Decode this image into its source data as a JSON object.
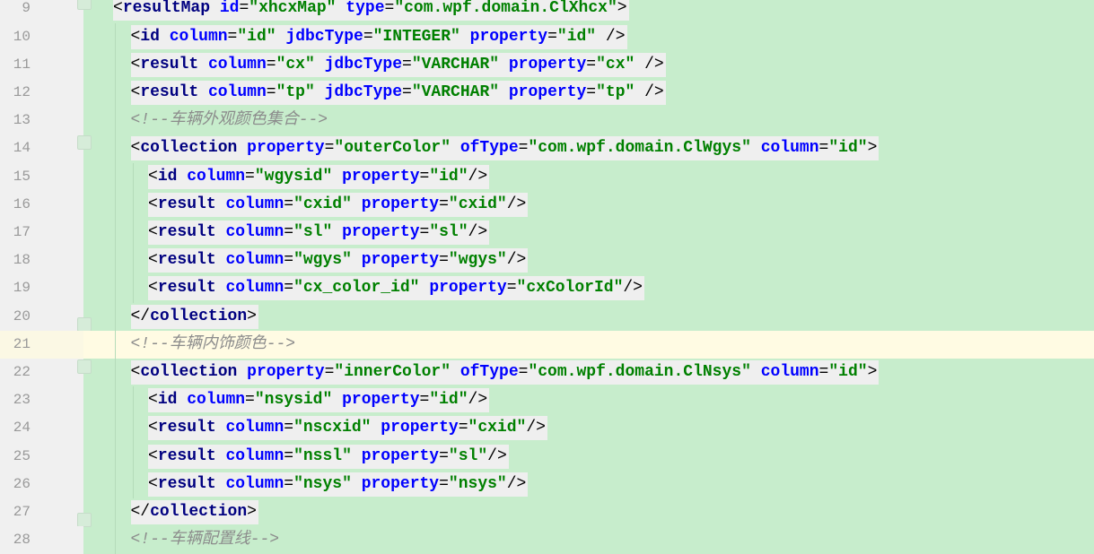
{
  "editor": {
    "current_line": 21,
    "colors": {
      "tag": "#000080",
      "attribute": "#0000ff",
      "value": "#008000",
      "comment": "#8c8c8c",
      "background": "#c7edcc",
      "current_line": "#fffbe3"
    },
    "lines": [
      {
        "n": "9",
        "indent": 0,
        "fold": "start",
        "tokens": [
          [
            "punct",
            "<"
          ],
          [
            "tag",
            "resultMap"
          ],
          [
            "punct",
            " "
          ],
          [
            "attr",
            "id"
          ],
          [
            "punct",
            "="
          ],
          [
            "val",
            "\"xhcxMap\""
          ],
          [
            "punct",
            " "
          ],
          [
            "attr",
            "type"
          ],
          [
            "punct",
            "="
          ],
          [
            "val",
            "\"com.wpf.domain.ClXhcx\""
          ],
          [
            "punct",
            ">"
          ]
        ]
      },
      {
        "n": "10",
        "indent": 1,
        "tokens": [
          [
            "punct",
            "<"
          ],
          [
            "tag",
            "id"
          ],
          [
            "punct",
            " "
          ],
          [
            "attr",
            "column"
          ],
          [
            "punct",
            "="
          ],
          [
            "val",
            "\"id\""
          ],
          [
            "punct",
            " "
          ],
          [
            "attr",
            "jdbcType"
          ],
          [
            "punct",
            "="
          ],
          [
            "val",
            "\"INTEGER\""
          ],
          [
            "punct",
            " "
          ],
          [
            "attr",
            "property"
          ],
          [
            "punct",
            "="
          ],
          [
            "val",
            "\"id\""
          ],
          [
            "punct",
            " />"
          ]
        ]
      },
      {
        "n": "11",
        "indent": 1,
        "tokens": [
          [
            "punct",
            "<"
          ],
          [
            "tag",
            "result"
          ],
          [
            "punct",
            " "
          ],
          [
            "attr",
            "column"
          ],
          [
            "punct",
            "="
          ],
          [
            "val",
            "\"cx\""
          ],
          [
            "punct",
            " "
          ],
          [
            "attr",
            "jdbcType"
          ],
          [
            "punct",
            "="
          ],
          [
            "val",
            "\"VARCHAR\""
          ],
          [
            "punct",
            " "
          ],
          [
            "attr",
            "property"
          ],
          [
            "punct",
            "="
          ],
          [
            "val",
            "\"cx\""
          ],
          [
            "punct",
            " />"
          ]
        ]
      },
      {
        "n": "12",
        "indent": 1,
        "tokens": [
          [
            "punct",
            "<"
          ],
          [
            "tag",
            "result"
          ],
          [
            "punct",
            " "
          ],
          [
            "attr",
            "column"
          ],
          [
            "punct",
            "="
          ],
          [
            "val",
            "\"tp\""
          ],
          [
            "punct",
            " "
          ],
          [
            "attr",
            "jdbcType"
          ],
          [
            "punct",
            "="
          ],
          [
            "val",
            "\"VARCHAR\""
          ],
          [
            "punct",
            " "
          ],
          [
            "attr",
            "property"
          ],
          [
            "punct",
            "="
          ],
          [
            "val",
            "\"tp\""
          ],
          [
            "punct",
            " />"
          ]
        ]
      },
      {
        "n": "13",
        "indent": 1,
        "comment": true,
        "tokens": [
          [
            "cmt",
            "<!--车辆外观颜色集合-->"
          ]
        ]
      },
      {
        "n": "14",
        "indent": 1,
        "fold": "start",
        "tokens": [
          [
            "punct",
            "<"
          ],
          [
            "tag",
            "collection"
          ],
          [
            "punct",
            " "
          ],
          [
            "attr",
            "property"
          ],
          [
            "punct",
            "="
          ],
          [
            "val",
            "\"outerColor\""
          ],
          [
            "punct",
            " "
          ],
          [
            "attr",
            "ofType"
          ],
          [
            "punct",
            "="
          ],
          [
            "val",
            "\"com.wpf.domain.ClWgys\""
          ],
          [
            "punct",
            " "
          ],
          [
            "attr",
            "column"
          ],
          [
            "punct",
            "="
          ],
          [
            "val",
            "\"id\""
          ],
          [
            "punct",
            ">"
          ]
        ]
      },
      {
        "n": "15",
        "indent": 2,
        "tokens": [
          [
            "punct",
            "<"
          ],
          [
            "tag",
            "id"
          ],
          [
            "punct",
            " "
          ],
          [
            "attr",
            "column"
          ],
          [
            "punct",
            "="
          ],
          [
            "val",
            "\"wgysid\""
          ],
          [
            "punct",
            " "
          ],
          [
            "attr",
            "property"
          ],
          [
            "punct",
            "="
          ],
          [
            "val",
            "\"id\""
          ],
          [
            "punct",
            "/>"
          ]
        ]
      },
      {
        "n": "16",
        "indent": 2,
        "tokens": [
          [
            "punct",
            "<"
          ],
          [
            "tag",
            "result"
          ],
          [
            "punct",
            " "
          ],
          [
            "attr",
            "column"
          ],
          [
            "punct",
            "="
          ],
          [
            "val",
            "\"cxid\""
          ],
          [
            "punct",
            " "
          ],
          [
            "attr",
            "property"
          ],
          [
            "punct",
            "="
          ],
          [
            "val",
            "\"cxid\""
          ],
          [
            "punct",
            "/>"
          ]
        ]
      },
      {
        "n": "17",
        "indent": 2,
        "tokens": [
          [
            "punct",
            "<"
          ],
          [
            "tag",
            "result"
          ],
          [
            "punct",
            " "
          ],
          [
            "attr",
            "column"
          ],
          [
            "punct",
            "="
          ],
          [
            "val",
            "\"sl\""
          ],
          [
            "punct",
            " "
          ],
          [
            "attr",
            "property"
          ],
          [
            "punct",
            "="
          ],
          [
            "val",
            "\"sl\""
          ],
          [
            "punct",
            "/>"
          ]
        ]
      },
      {
        "n": "18",
        "indent": 2,
        "tokens": [
          [
            "punct",
            "<"
          ],
          [
            "tag",
            "result"
          ],
          [
            "punct",
            " "
          ],
          [
            "attr",
            "column"
          ],
          [
            "punct",
            "="
          ],
          [
            "val",
            "\"wgys\""
          ],
          [
            "punct",
            " "
          ],
          [
            "attr",
            "property"
          ],
          [
            "punct",
            "="
          ],
          [
            "val",
            "\"wgys\""
          ],
          [
            "punct",
            "/>"
          ]
        ]
      },
      {
        "n": "19",
        "indent": 2,
        "tokens": [
          [
            "punct",
            "<"
          ],
          [
            "tag",
            "result"
          ],
          [
            "punct",
            " "
          ],
          [
            "attr",
            "column"
          ],
          [
            "punct",
            "="
          ],
          [
            "val",
            "\"cx_color_id\""
          ],
          [
            "punct",
            " "
          ],
          [
            "attr",
            "property"
          ],
          [
            "punct",
            "="
          ],
          [
            "val",
            "\"cxColorId\""
          ],
          [
            "punct",
            "/>"
          ]
        ]
      },
      {
        "n": "20",
        "indent": 1,
        "fold": "end",
        "tokens": [
          [
            "punct",
            "</"
          ],
          [
            "tag",
            "collection"
          ],
          [
            "punct",
            ">"
          ]
        ]
      },
      {
        "n": "21",
        "indent": 1,
        "comment": true,
        "tokens": [
          [
            "cmt",
            "<!--车辆内饰颜色-->"
          ]
        ]
      },
      {
        "n": "22",
        "indent": 1,
        "fold": "start",
        "tokens": [
          [
            "punct",
            "<"
          ],
          [
            "tag",
            "collection"
          ],
          [
            "punct",
            " "
          ],
          [
            "attr",
            "property"
          ],
          [
            "punct",
            "="
          ],
          [
            "val",
            "\"innerColor\""
          ],
          [
            "punct",
            " "
          ],
          [
            "attr",
            "ofType"
          ],
          [
            "punct",
            "="
          ],
          [
            "val",
            "\"com.wpf.domain.ClNsys\""
          ],
          [
            "punct",
            " "
          ],
          [
            "attr",
            "column"
          ],
          [
            "punct",
            "="
          ],
          [
            "val",
            "\"id\""
          ],
          [
            "punct",
            ">"
          ]
        ]
      },
      {
        "n": "23",
        "indent": 2,
        "tokens": [
          [
            "punct",
            "<"
          ],
          [
            "tag",
            "id"
          ],
          [
            "punct",
            " "
          ],
          [
            "attr",
            "column"
          ],
          [
            "punct",
            "="
          ],
          [
            "val",
            "\"nsysid\""
          ],
          [
            "punct",
            " "
          ],
          [
            "attr",
            "property"
          ],
          [
            "punct",
            "="
          ],
          [
            "val",
            "\"id\""
          ],
          [
            "punct",
            "/>"
          ]
        ]
      },
      {
        "n": "24",
        "indent": 2,
        "tokens": [
          [
            "punct",
            "<"
          ],
          [
            "tag",
            "result"
          ],
          [
            "punct",
            " "
          ],
          [
            "attr",
            "column"
          ],
          [
            "punct",
            "="
          ],
          [
            "val",
            "\"nscxid\""
          ],
          [
            "punct",
            " "
          ],
          [
            "attr",
            "property"
          ],
          [
            "punct",
            "="
          ],
          [
            "val",
            "\"cxid\""
          ],
          [
            "punct",
            "/>"
          ]
        ]
      },
      {
        "n": "25",
        "indent": 2,
        "tokens": [
          [
            "punct",
            "<"
          ],
          [
            "tag",
            "result"
          ],
          [
            "punct",
            " "
          ],
          [
            "attr",
            "column"
          ],
          [
            "punct",
            "="
          ],
          [
            "val",
            "\"nssl\""
          ],
          [
            "punct",
            " "
          ],
          [
            "attr",
            "property"
          ],
          [
            "punct",
            "="
          ],
          [
            "val",
            "\"sl\""
          ],
          [
            "punct",
            "/>"
          ]
        ]
      },
      {
        "n": "26",
        "indent": 2,
        "tokens": [
          [
            "punct",
            "<"
          ],
          [
            "tag",
            "result"
          ],
          [
            "punct",
            " "
          ],
          [
            "attr",
            "column"
          ],
          [
            "punct",
            "="
          ],
          [
            "val",
            "\"nsys\""
          ],
          [
            "punct",
            " "
          ],
          [
            "attr",
            "property"
          ],
          [
            "punct",
            "="
          ],
          [
            "val",
            "\"nsys\""
          ],
          [
            "punct",
            "/>"
          ]
        ]
      },
      {
        "n": "27",
        "indent": 1,
        "fold": "end",
        "tokens": [
          [
            "punct",
            "</"
          ],
          [
            "tag",
            "collection"
          ],
          [
            "punct",
            ">"
          ]
        ]
      },
      {
        "n": "28",
        "indent": 1,
        "comment": true,
        "tokens": [
          [
            "cmt",
            "<!--车辆配置线-->"
          ]
        ]
      }
    ]
  }
}
